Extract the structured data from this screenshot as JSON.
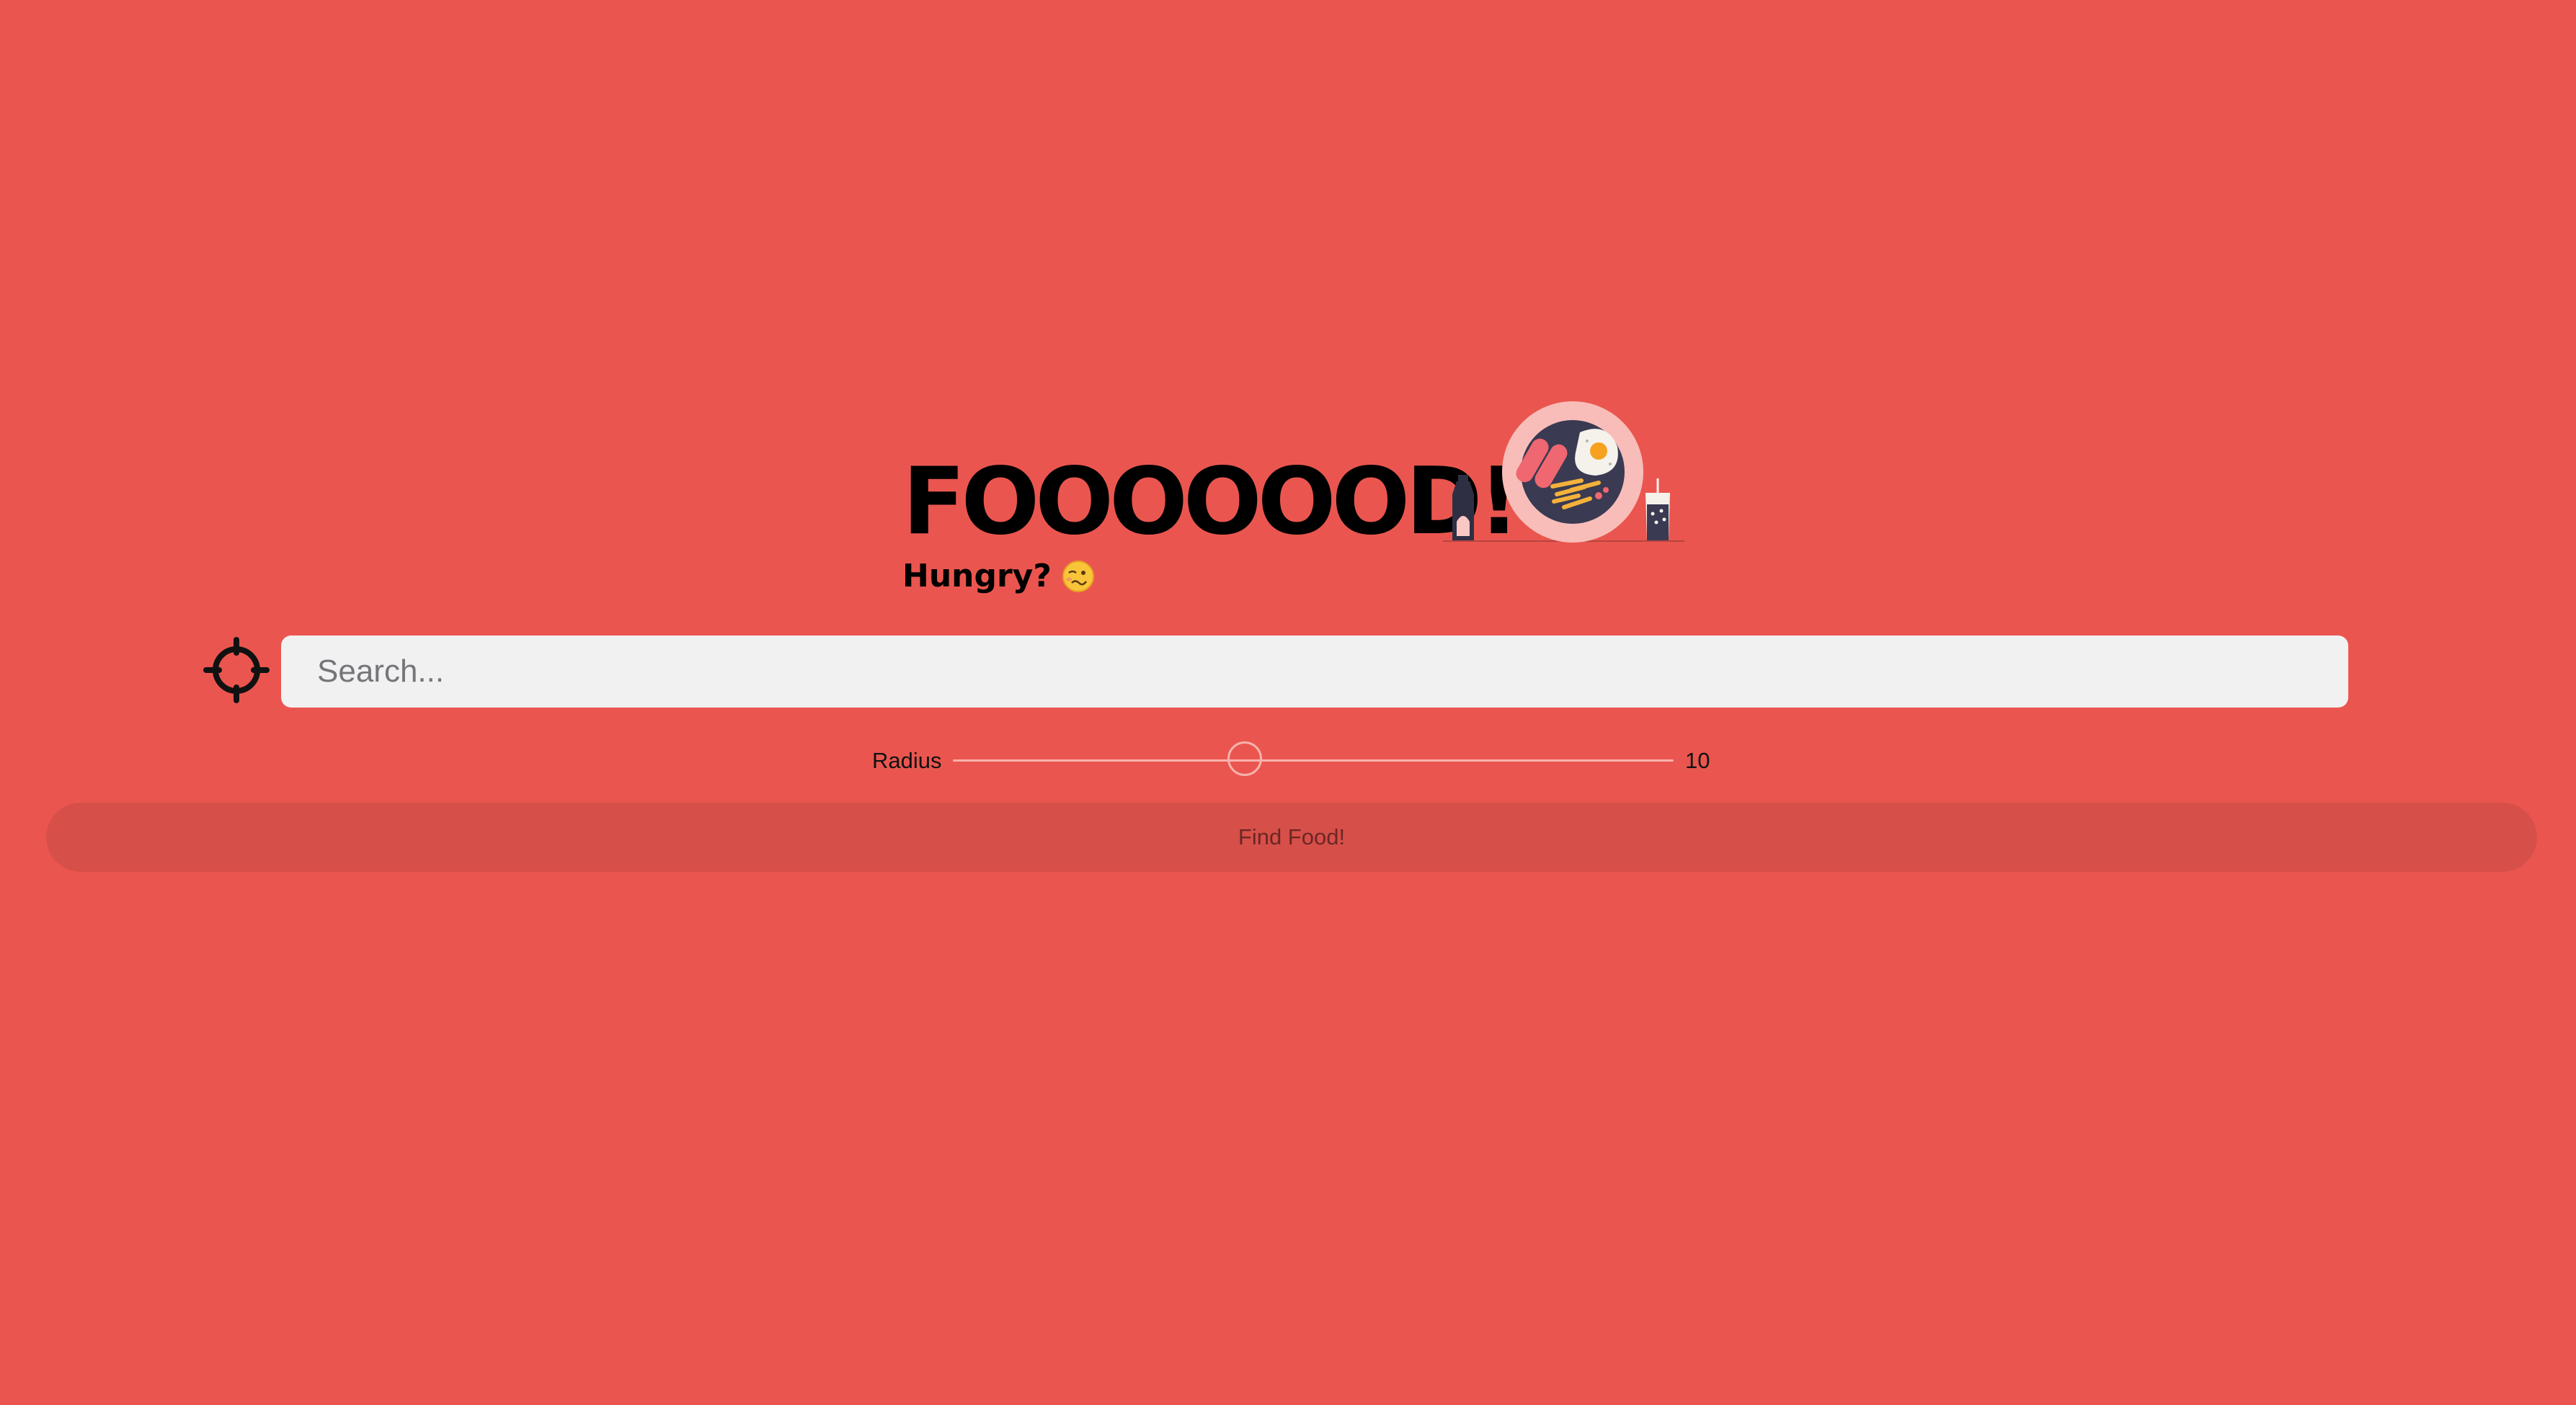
{
  "header": {
    "title": "FOOOOOOD!",
    "subtitle": "Hungry?"
  },
  "icons": {
    "subtitle_emoji": "woozy-face-icon",
    "illustration": "breakfast-plate-illustration",
    "locate": "crosshair-icon"
  },
  "search": {
    "placeholder": "Search...",
    "value": ""
  },
  "radius": {
    "label": "Radius",
    "value": "10",
    "level": 0.405
  },
  "actions": {
    "find_label": "Find Food!"
  },
  "colors": {
    "background": "#ea564f",
    "button": "#d74f49",
    "search_field": "#f1f1f2"
  }
}
